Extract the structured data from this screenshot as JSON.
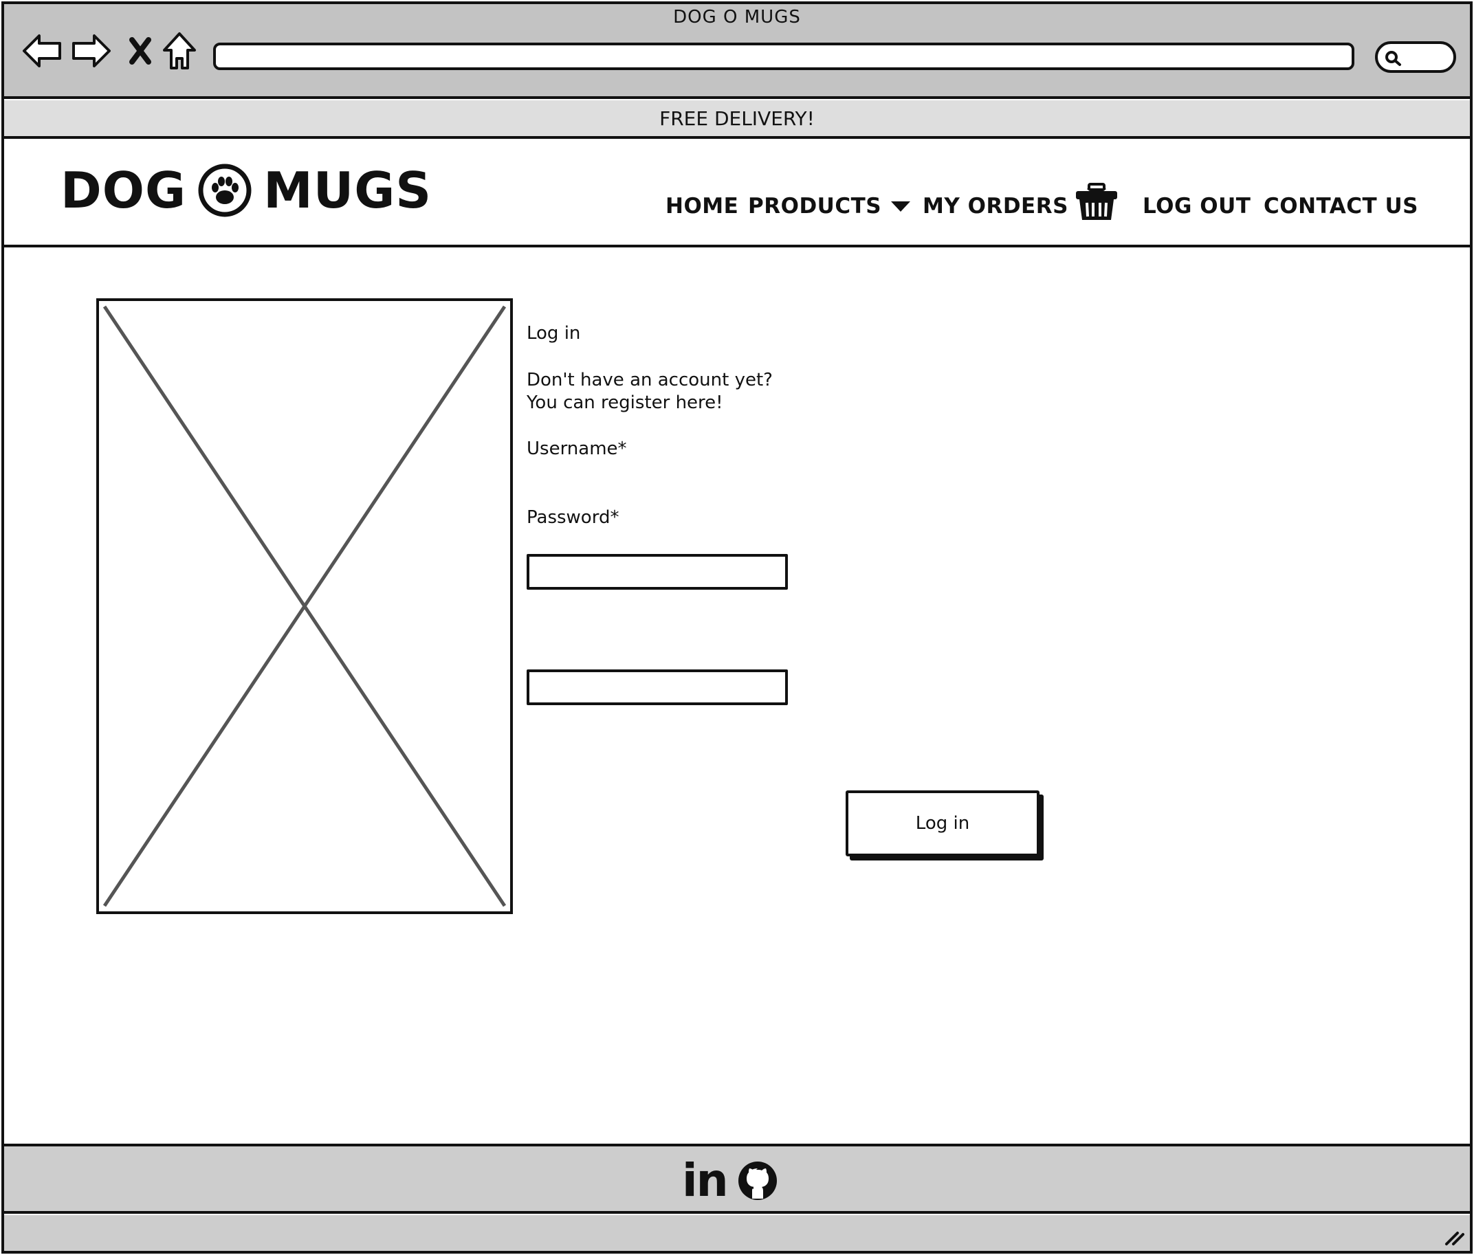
{
  "browser": {
    "title": "DOG O MUGS",
    "url": "",
    "icons": [
      "back-arrow-icon",
      "forward-arrow-icon",
      "close-icon",
      "home-icon",
      "search-icon"
    ]
  },
  "promo": {
    "text": "FREE DELIVERY!"
  },
  "header": {
    "logo": {
      "left": "DOG",
      "right": "MUGS",
      "icon": "paw-icon"
    },
    "nav": {
      "home": "HOME",
      "products": "PRODUCTS",
      "my_orders": "MY ORDERS",
      "basket_icon": "basket-icon",
      "log_out": "LOG OUT",
      "contact_us": "CONTACT US"
    }
  },
  "login": {
    "heading": "Log in",
    "register_line1": "Don't have an account yet?",
    "register_line2": "You can register here!",
    "username_label": "Username*",
    "password_label": "Password*",
    "username_value": "",
    "password_value": "",
    "button_label": "Log in"
  },
  "footer": {
    "linkedin_text": "in",
    "icons": [
      "linkedin-icon",
      "github-icon"
    ]
  }
}
